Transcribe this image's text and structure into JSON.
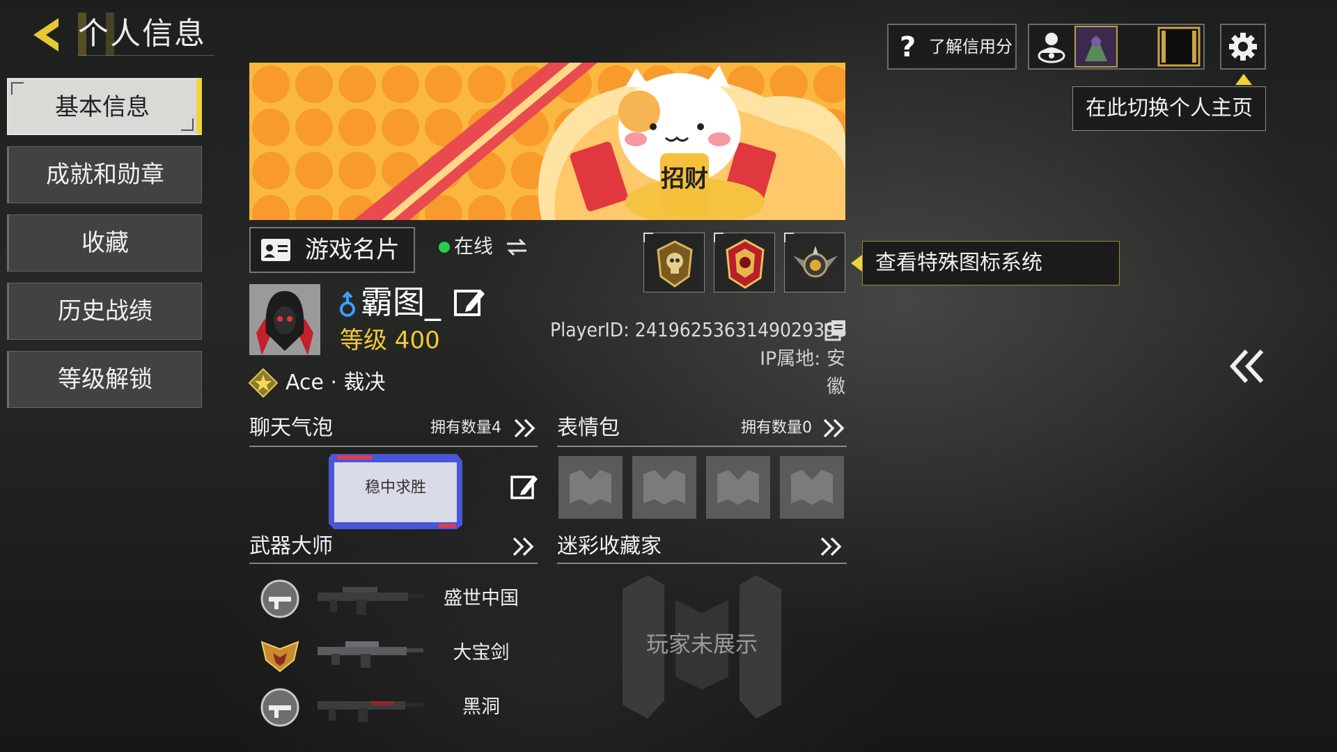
{
  "header": {
    "title": "个人信息"
  },
  "sidebar": {
    "items": [
      {
        "label": "基本信息",
        "active": true
      },
      {
        "label": "成就和勋章"
      },
      {
        "label": "收藏"
      },
      {
        "label": "历史战绩"
      },
      {
        "label": "等级解锁"
      }
    ]
  },
  "banner": {
    "text": "招财"
  },
  "profile": {
    "card_tab": "游戏名片",
    "status": "在线",
    "name": "霸图_",
    "level": "等级 400",
    "rank": "Ace · 裁决",
    "player_id": "PlayerID: 2419625363149029398",
    "ip": "IP属地: 安徽"
  },
  "special_icons": {
    "tooltip": "查看特殊图标系统"
  },
  "chat_bubble": {
    "title": "聊天气泡",
    "count": "拥有数量4",
    "bubble_text": "稳中求胜"
  },
  "stickers": {
    "title": "表情包",
    "count": "拥有数量0"
  },
  "weapon_master": {
    "title": "武器大师",
    "weapons": [
      {
        "name": "盛世中国"
      },
      {
        "name": "大宝剑"
      },
      {
        "name": "黑洞"
      }
    ]
  },
  "camo_collector": {
    "title": "迷彩收藏家",
    "empty_text": "玩家未展示"
  },
  "toolbar": {
    "credit_label": "了解信用分",
    "switch_tip": "在此切换个人主页"
  },
  "colors": {
    "accent": "#f2d23b",
    "online": "#22d149",
    "level": "#f2c93a"
  }
}
